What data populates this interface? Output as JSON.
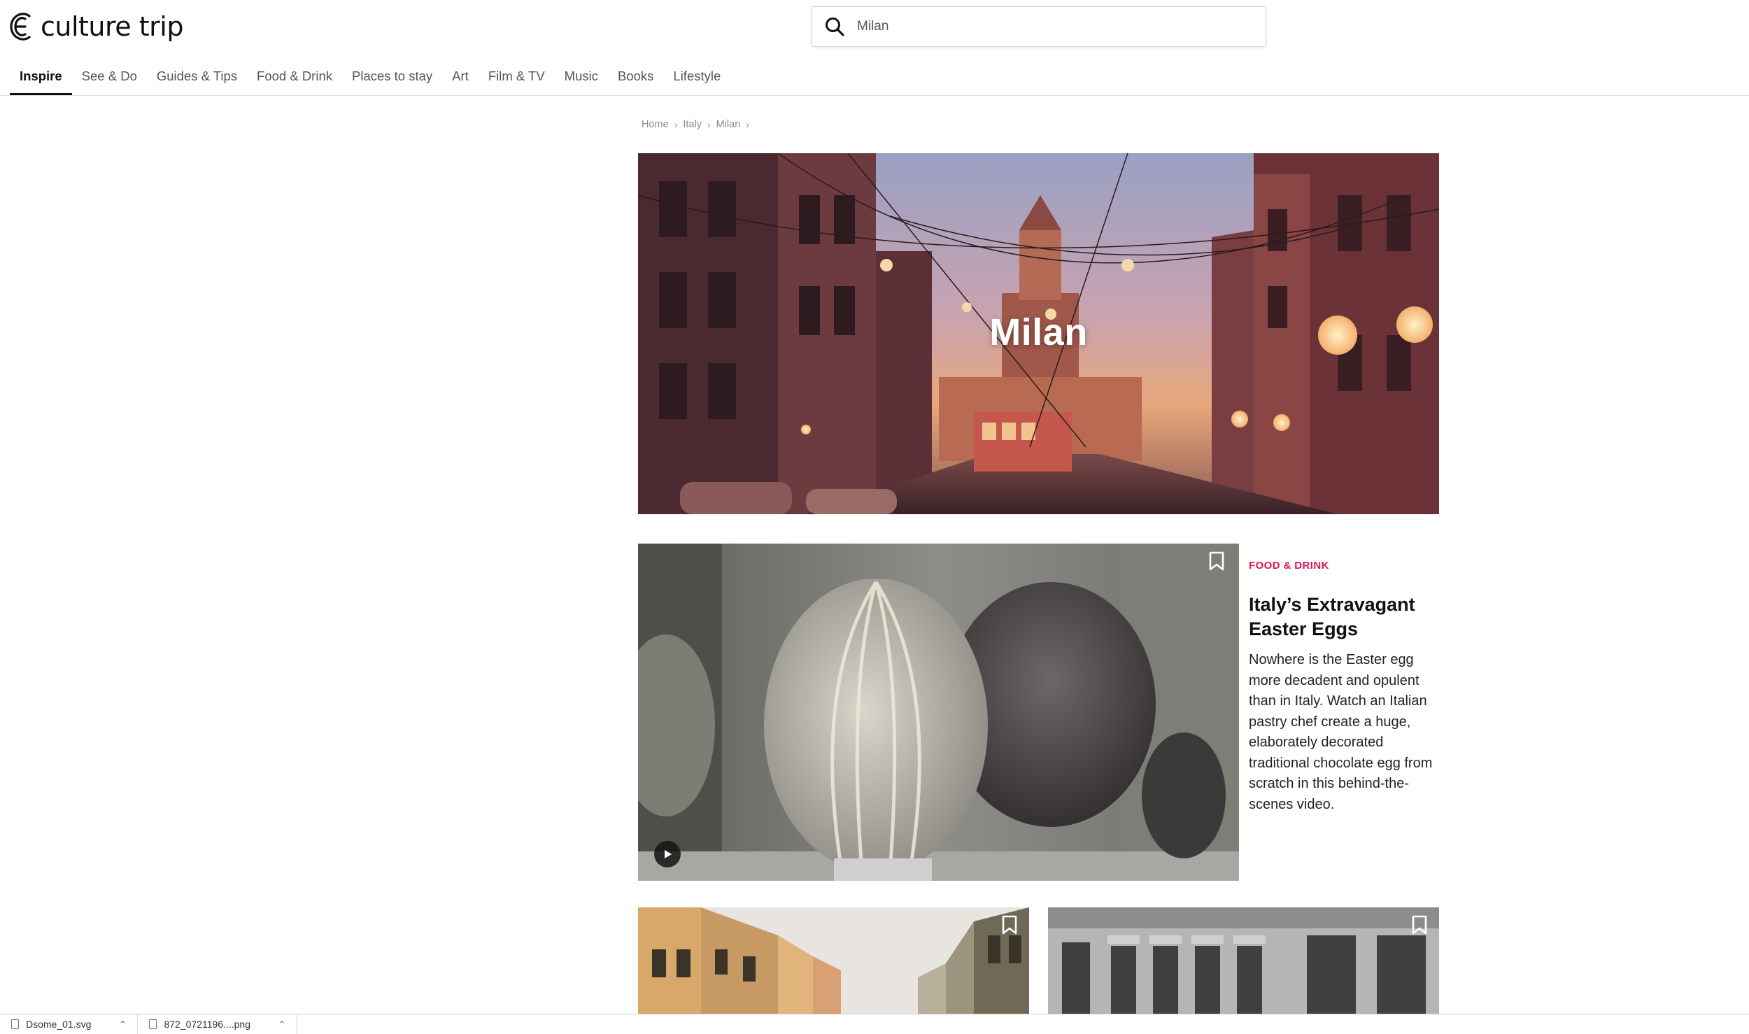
{
  "brand": {
    "logo_text": "culture trip",
    "accent_color": "#e0155a"
  },
  "search": {
    "value": "Milan",
    "icon": "search-icon"
  },
  "nav": {
    "items": [
      {
        "label": "Inspire",
        "active": true
      },
      {
        "label": "See & Do",
        "active": false
      },
      {
        "label": "Guides & Tips",
        "active": false
      },
      {
        "label": "Food & Drink",
        "active": false
      },
      {
        "label": "Places to stay",
        "active": false
      },
      {
        "label": "Art",
        "active": false
      },
      {
        "label": "Film & TV",
        "active": false
      },
      {
        "label": "Music",
        "active": false
      },
      {
        "label": "Books",
        "active": false
      },
      {
        "label": "Lifestyle",
        "active": false
      }
    ]
  },
  "breadcrumb": {
    "items": [
      "Home",
      "Italy",
      "Milan"
    ],
    "separator": "›"
  },
  "hero": {
    "title": "Milan"
  },
  "featured": {
    "category": "FOOD & DRINK",
    "title": "Italy’s Extravagant Easter Eggs",
    "description": "Nowhere is the Easter egg more decadent and opulent than in Italy. Watch an Italian pastry chef create a huge, elaborately decorated traditional chocolate egg from scratch in this behind-the-scenes video.",
    "has_video": true
  },
  "downloads": {
    "items": [
      {
        "name": "Dsome_01.svg",
        "icon": "file-icon"
      },
      {
        "name": "872_0721196....png",
        "icon": "file-icon"
      }
    ]
  }
}
